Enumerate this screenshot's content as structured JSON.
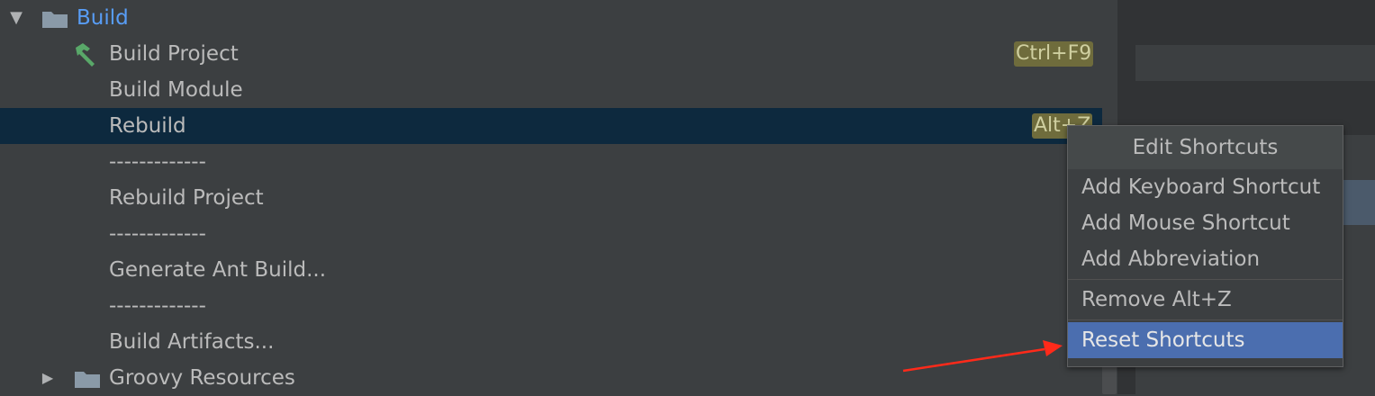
{
  "tree": {
    "build_folder": "Build",
    "items": [
      {
        "label": "Build Project",
        "shortcut": "Ctrl+F9"
      },
      {
        "label": "Build Module"
      },
      {
        "label": "Rebuild",
        "shortcut": "Alt+Z"
      },
      {
        "label": "-------------"
      },
      {
        "label": "Rebuild Project"
      },
      {
        "label": "-------------"
      },
      {
        "label": "Generate Ant Build..."
      },
      {
        "label": "-------------"
      },
      {
        "label": "Build Artifacts..."
      }
    ],
    "groovy_folder": "Groovy Resources"
  },
  "context_menu": {
    "title": "Edit Shortcuts",
    "items": [
      "Add Keyboard Shortcut",
      "Add Mouse Shortcut",
      "Add Abbreviation",
      "Remove Alt+Z",
      "Reset Shortcuts"
    ],
    "active_item": "Reset Shortcuts"
  },
  "colors": {
    "background": "#3c3f41",
    "selection": "#0d293e",
    "menu_active": "#4b6eaf",
    "shortcut_badge": "#6f6c3c",
    "folder_link": "#589df6",
    "annotation_arrow": "#ff2a1a"
  },
  "icons": [
    "expand-arrow-icon",
    "folder-icon",
    "hammer-icon",
    "collapse-arrow-icon"
  ]
}
